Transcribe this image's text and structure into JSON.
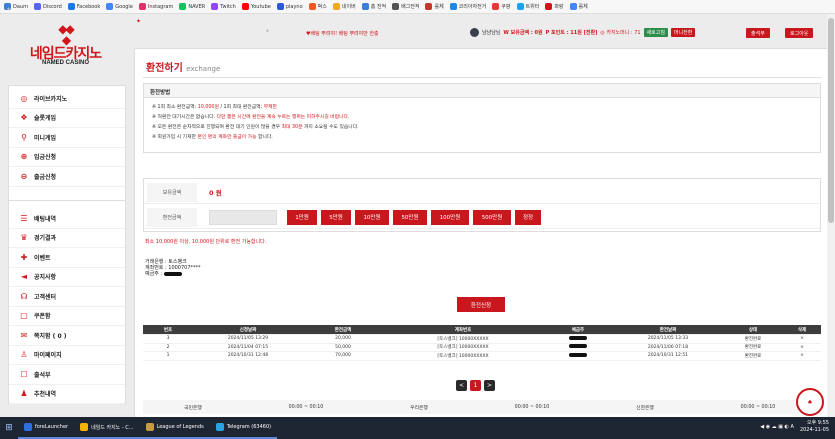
{
  "bookmarks": [
    {
      "label": "Daum",
      "color": "#3b7dd8"
    },
    {
      "label": "Discord",
      "color": "#5865f2"
    },
    {
      "label": "Facebook",
      "color": "#1877f2"
    },
    {
      "label": "Google",
      "color": "#4285f4"
    },
    {
      "label": "Instagram",
      "color": "#e1306c"
    },
    {
      "label": "NAVER",
      "color": "#03c75a"
    },
    {
      "label": "Twitch",
      "color": "#9146ff"
    },
    {
      "label": "Youtube",
      "color": "#ff0000"
    },
    {
      "label": "playno",
      "color": "#2a5bd7"
    },
    {
      "label": "벅스",
      "color": "#f15a24"
    },
    {
      "label": "네이버",
      "color": "#f5a623"
    },
    {
      "label": "홈 전적",
      "color": "#3b7dd8"
    },
    {
      "label": "배그전적",
      "color": "#555555"
    },
    {
      "label": "롤체",
      "color": "#c0392b"
    },
    {
      "label": "코리아자전거",
      "color": "#1e88e5"
    },
    {
      "label": "쿠팡",
      "color": "#e53935"
    },
    {
      "label": "트위터",
      "color": "#1da1f2"
    },
    {
      "label": "파랑",
      "color": "#d0161b"
    },
    {
      "label": "롤체",
      "color": "#4285f4"
    }
  ],
  "logo": {
    "name": "네임드카지노",
    "sub": "NAMED CASINO"
  },
  "sidebar_top": [
    {
      "label": "라이브카지노",
      "icon": "chip-icon"
    },
    {
      "label": "슬롯게임",
      "icon": "slot-icon"
    },
    {
      "label": "미니게임",
      "icon": "joystick-icon"
    },
    {
      "label": "입금신청",
      "icon": "deposit-icon"
    },
    {
      "label": "출금신청",
      "icon": "withdraw-icon"
    }
  ],
  "sidebar_bottom": [
    {
      "label": "배팅내역",
      "icon": "list-icon"
    },
    {
      "label": "경기결과",
      "icon": "trophy-icon"
    },
    {
      "label": "이벤트",
      "icon": "gift-icon"
    },
    {
      "label": "공지사항",
      "icon": "megaphone-icon"
    },
    {
      "label": "고객센터",
      "icon": "headset-icon"
    },
    {
      "label": "쿠폰함",
      "icon": "coupon-icon"
    },
    {
      "label": "쪽지함 ( 0 )",
      "icon": "mail-icon"
    },
    {
      "label": "마이페이지",
      "icon": "user-icon"
    },
    {
      "label": "출석부",
      "icon": "calendar-icon"
    },
    {
      "label": "추천내역",
      "icon": "referral-icon"
    }
  ],
  "header": {
    "notice": "♥배팅 뿌려야! 배팅 뿌려야만 한충",
    "username": "냠냠냠님",
    "holding_label": "W 보유금액 : 0원",
    "point_label": "P 포인트 : 11원 [전환]",
    "mini_label": "◎ 카지노머니 : 71",
    "refresh": "새로고침",
    "mini_convert": "머니전환",
    "deposit_btn": "출석부",
    "logout_btn": "로그아웃"
  },
  "page": {
    "title": "환전하기",
    "title_en": "exchange",
    "method_title": "환전방법",
    "info": [
      {
        "pre": "※ 1회 최소 환전금액: ",
        "red": "10,000원",
        "post": " / 1회 최대 환전금액: ",
        "red2": "무제한",
        "post2": ""
      },
      {
        "pre": "※ 처환전 대기시간은 없습니다. ",
        "red": "다만 짧은 시간에 환전을 계속 누르는 행위는 피하주시길 바랍니다.",
        "post": "",
        "red2": "",
        "post2": ""
      },
      {
        "pre": "※ 모든 환전은 순차적으로 진행되며 환전 대기 인원이 많을 경우 ",
        "red": "최대 30분",
        "post": " 까지 소요될 수도 있습니다.",
        "red2": "",
        "post2": ""
      },
      {
        "pre": "※ 회원가입 시 기재한 ",
        "red": "본인 명의 계좌만 출금이 가능",
        "post": " 합니다.",
        "red2": "",
        "post2": ""
      }
    ],
    "holding_label": "보유금액",
    "holding_value": "0 원",
    "amount_label": "환전금액",
    "amount_buttons": [
      "1만원",
      "5만원",
      "10만원",
      "50만원",
      "100만원",
      "500만원",
      "정정"
    ],
    "hint": "최소 10,000원 이상, 10,000원 단위로 환전 가능합니다.",
    "bank_name": "거래은행 : 토스뱅크",
    "account": "계좌번호 : 1000707****",
    "holder": "예금주 :",
    "apply": "환전신청"
  },
  "table": {
    "headers": [
      "번호",
      "신청날짜",
      "환전금액",
      "계좌번호",
      "예금주",
      "환전날짜",
      "상태",
      "삭제"
    ],
    "rows": [
      [
        "3",
        "2024/11/05 13:29",
        "20,000",
        "[토스뱅크] 10000XXXXX",
        "",
        "2024/11/05 13:33",
        "환전완료",
        "×"
      ],
      [
        "2",
        "2024/11/04 07:15",
        "50,000",
        "[토스뱅크] 10000XXXXX",
        "",
        "2024/11/06 07:18",
        "환전완료",
        "×"
      ],
      [
        "1",
        "2024/10/31 12:48",
        "70,000",
        "[토스뱅크] 10000XXXXX",
        "",
        "2024/10/31 12:51",
        "환전완료",
        "×"
      ]
    ]
  },
  "pager": {
    "prev": "<",
    "current": "1",
    "next": ">"
  },
  "bank_hours": [
    {
      "bank": "국민은행",
      "time": "00:00 ~ 00:10"
    },
    {
      "bank": "우리은행",
      "time": "00:00 ~ 00:10"
    },
    {
      "bank": "신한은행",
      "time": "00:00 ~ 00:10"
    }
  ],
  "taskbar": {
    "apps": [
      {
        "label": "foreLauncher",
        "color": "#2f6fe0"
      },
      {
        "label": "네임드 카지노 - C...",
        "color": "#f5b400"
      },
      {
        "label": "League of Legends",
        "color": "#c89b3c"
      },
      {
        "label": "Telegram (63460)",
        "color": "#2aa3e0"
      }
    ],
    "time": "오후 9:55",
    "date": "2024-11-05"
  }
}
